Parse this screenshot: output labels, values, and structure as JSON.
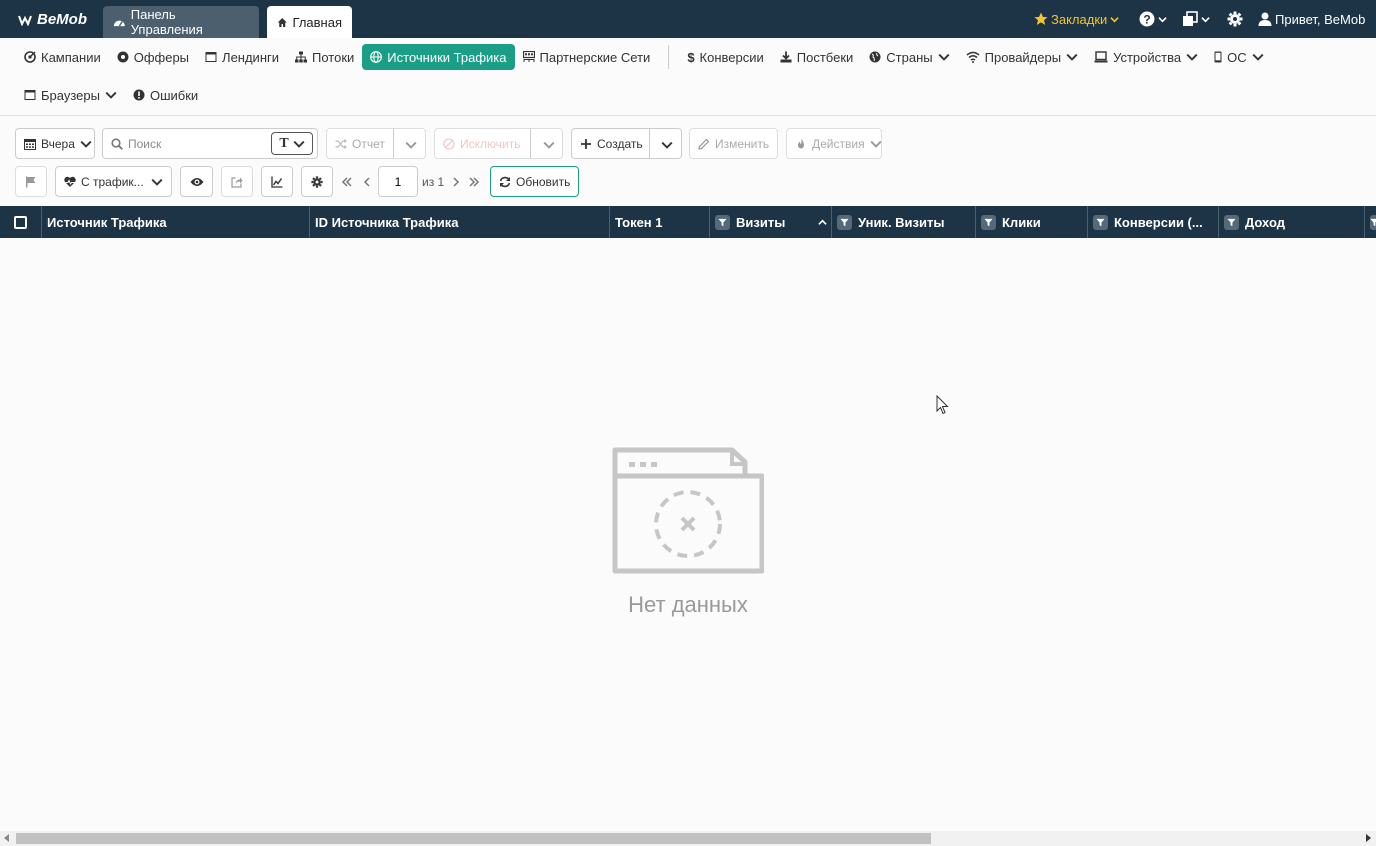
{
  "topbar": {
    "logo": "BeMob",
    "tabs": [
      {
        "label": "Панель Управления",
        "icon": "dashboard-icon"
      },
      {
        "label": "Главная",
        "icon": "home-icon"
      }
    ],
    "bookmarks_label": "Закладки",
    "user_label": "Привет, BeMob",
    "accent_color": "#f4c430",
    "bg_color": "#1c3446"
  },
  "nav": {
    "row1": [
      {
        "label": "Кампании",
        "icon": "campaign-icon"
      },
      {
        "label": "Офферы",
        "icon": "offer-icon"
      },
      {
        "label": "Лендинги",
        "icon": "landing-icon"
      },
      {
        "label": "Потоки",
        "icon": "flow-icon"
      },
      {
        "label": "Источники Трафика",
        "icon": "globe-icon",
        "active": true
      },
      {
        "label": "Партнерские Сети",
        "icon": "network-icon"
      },
      {
        "label": "Конверсии",
        "icon": "dollar-icon"
      },
      {
        "label": "Постбеки",
        "icon": "download-icon"
      },
      {
        "label": "Страны",
        "icon": "globe-icon",
        "dropdown": true
      },
      {
        "label": "Провайдеры",
        "icon": "wifi-icon",
        "dropdown": true
      },
      {
        "label": "Устройства",
        "icon": "laptop-icon",
        "dropdown": true
      },
      {
        "label": "ОС",
        "icon": "mobile-icon",
        "dropdown": true
      }
    ],
    "row2": [
      {
        "label": "Браузеры",
        "icon": "browser-icon",
        "dropdown": true
      },
      {
        "label": "Ошибки",
        "icon": "error-icon"
      }
    ],
    "active_color": "#1b9e86"
  },
  "toolbar": {
    "date_label": "Вчера",
    "search_placeholder": "Поиск",
    "report_label": "Отчет",
    "exclude_label": "Исключить",
    "create_label": "Создать",
    "edit_label": "Изменить",
    "actions_label": "Действия",
    "traffic_filter_label": "С трафик...",
    "page_value": "1",
    "page_total_label": "из 1",
    "refresh_label": "Обновить"
  },
  "table": {
    "columns": [
      {
        "label": "Источник Трафика",
        "filter": false
      },
      {
        "label": "ID Источника Трафика",
        "filter": false
      },
      {
        "label": "Токен 1",
        "filter": false
      },
      {
        "label": "Визиты",
        "filter": true,
        "sorted": "asc"
      },
      {
        "label": "Уник. Визиты",
        "filter": true
      },
      {
        "label": "Клики",
        "filter": true
      },
      {
        "label": "Конверсии (...",
        "filter": true
      },
      {
        "label": "Доход",
        "filter": true
      }
    ],
    "empty_text": "Нет данных"
  }
}
